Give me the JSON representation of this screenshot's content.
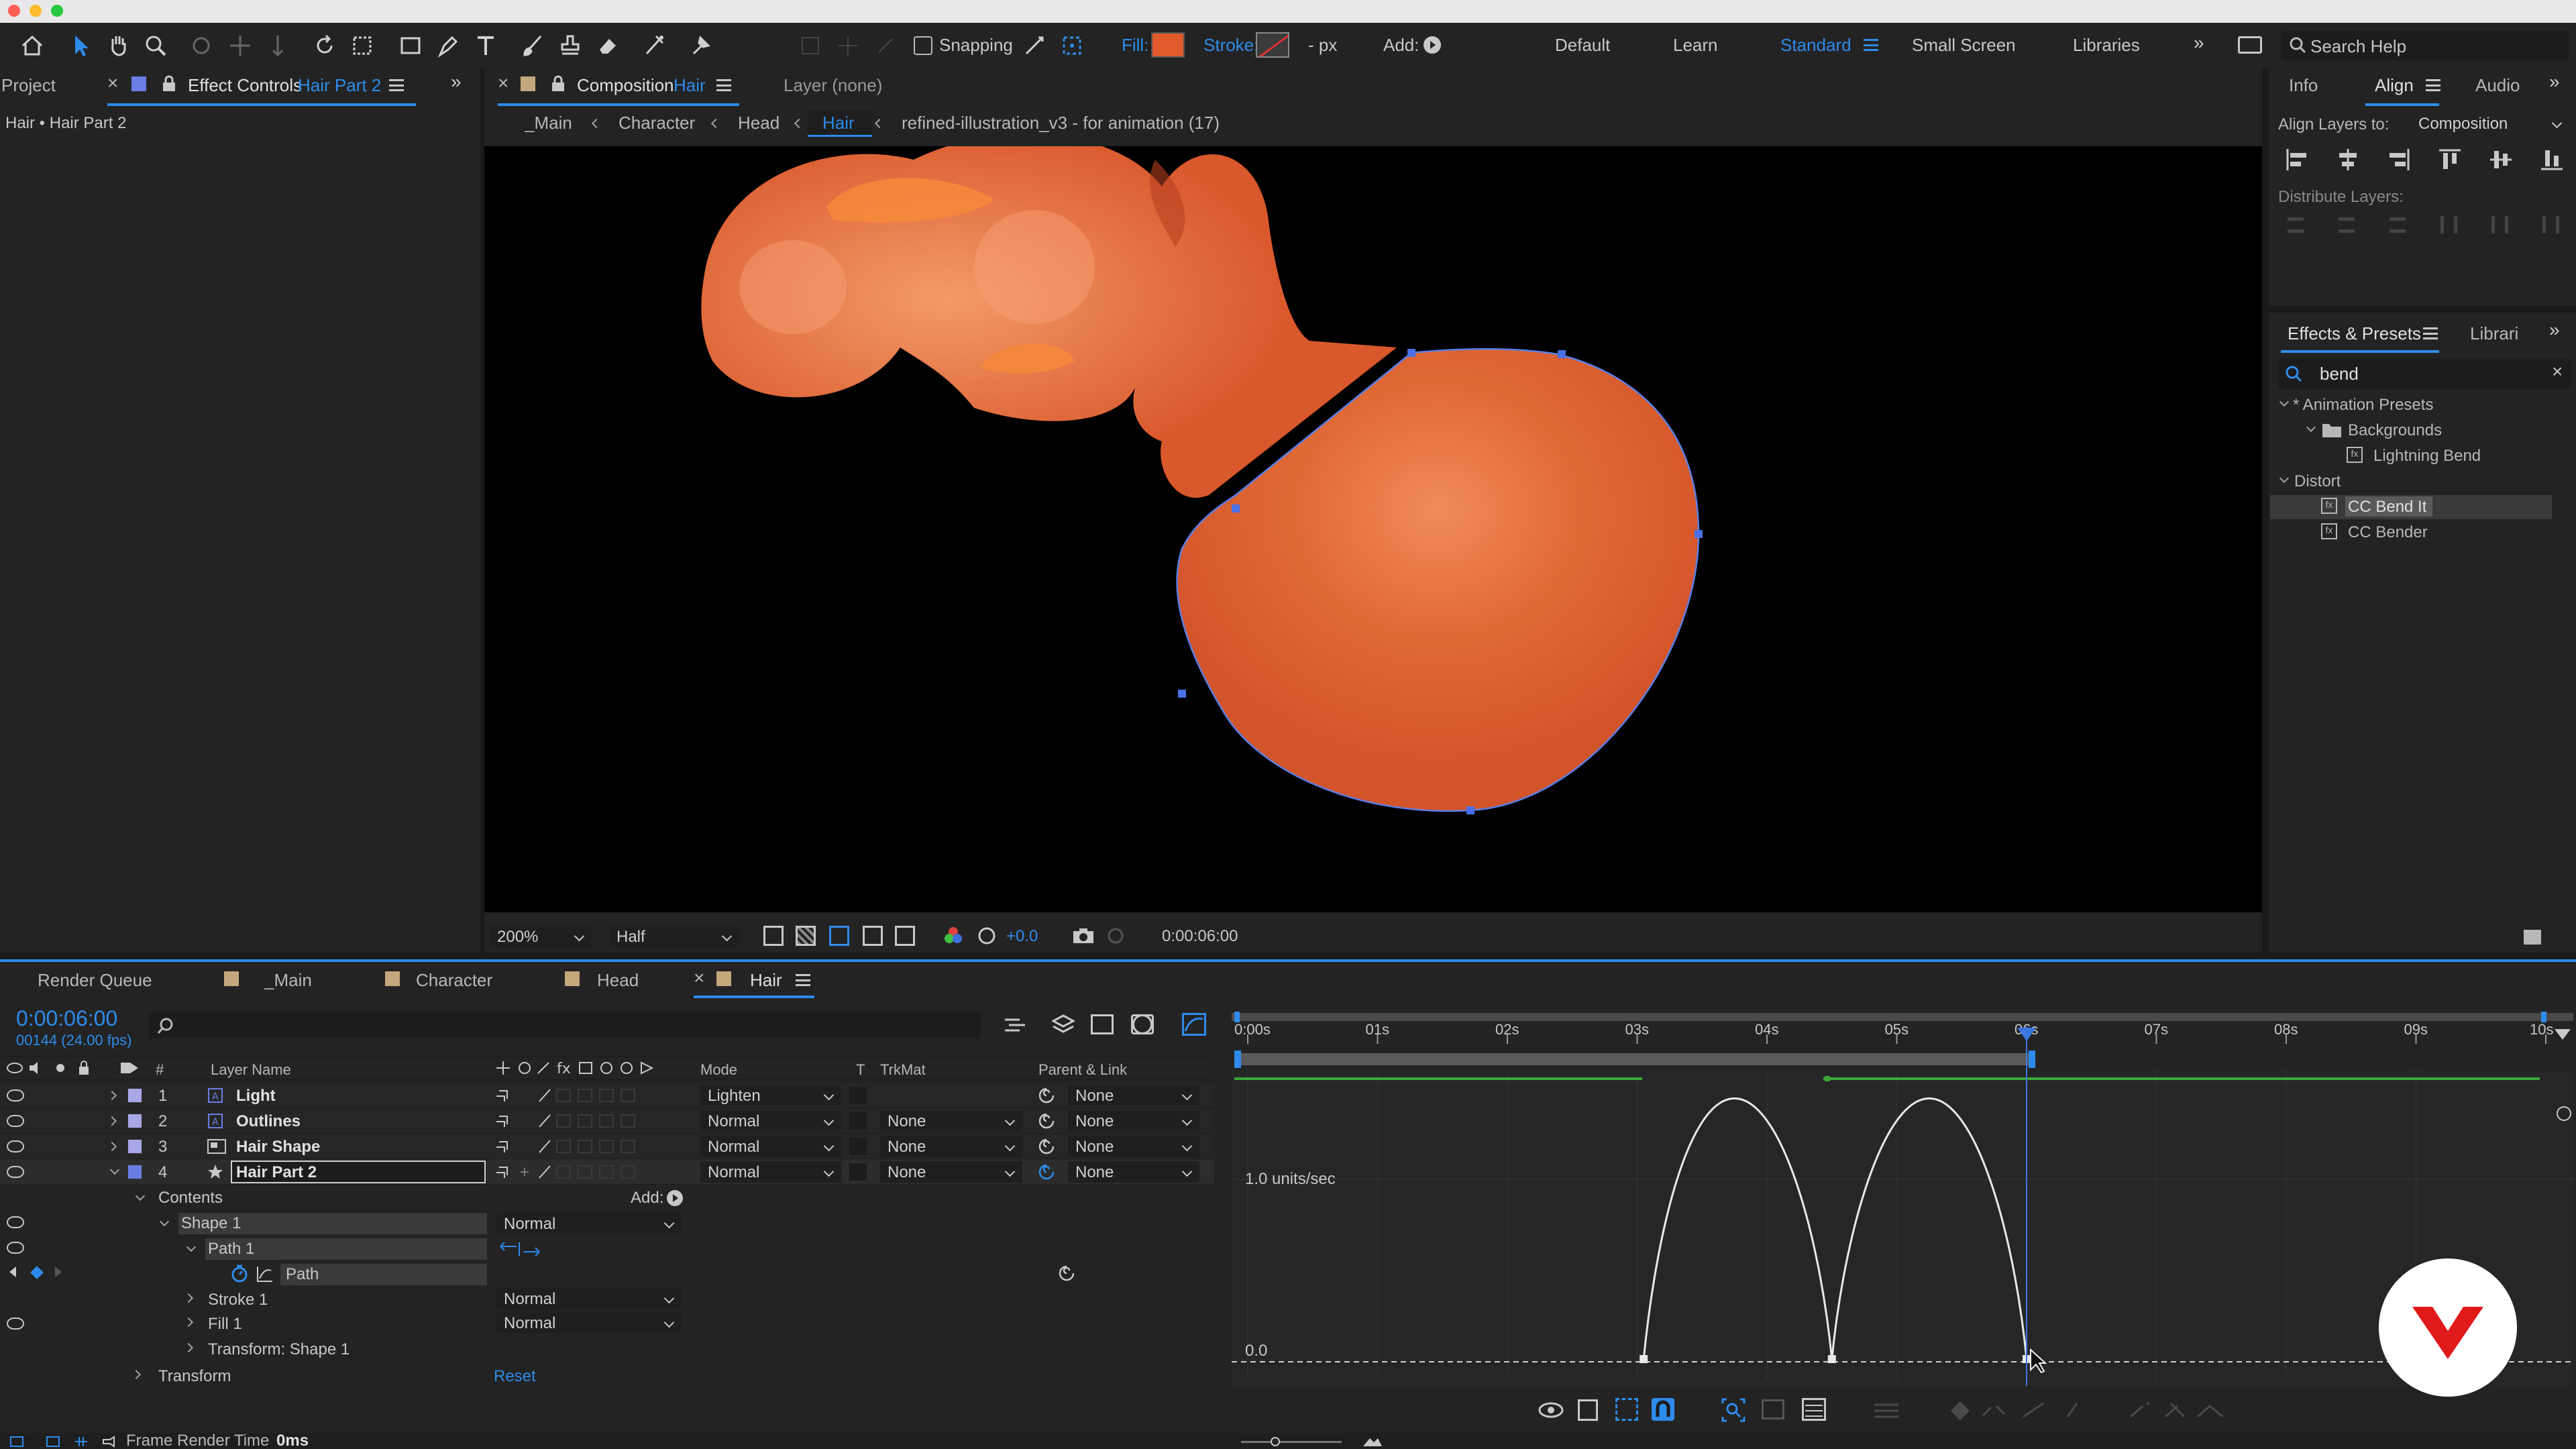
{
  "toolbar": {
    "snapping": "Snapping",
    "fill": "Fill:",
    "stroke": "Stroke:",
    "px": "- px",
    "add": "Add:",
    "workspaces": [
      "Default",
      "Learn",
      "Standard",
      "Small Screen",
      "Libraries"
    ],
    "search": "Search Help",
    "colors": {
      "fill": "#e05a2b",
      "accent": "#2d8ceb"
    }
  },
  "left_panel": {
    "tab_project": "Project",
    "tab_effect_controls": "Effect Controls",
    "effect_target": "Hair Part 2",
    "breadcrumb": "Hair • Hair Part 2"
  },
  "comp_panel": {
    "tab_composition": "Composition",
    "comp_name": "Hair",
    "layer_tab": "Layer (none)",
    "crumbs": [
      "_Main",
      "Character",
      "Head",
      "Hair"
    ],
    "crumb_tail": "refined-illustration_v3 - for animation (17)",
    "zoom": "200%",
    "resolution": "Half",
    "exposure": "+0.0",
    "timecode": "0:00:06:00"
  },
  "right_panel": {
    "tabs": [
      "Info",
      "Align",
      "Audio"
    ],
    "align_to_label": "Align Layers to:",
    "align_to_value": "Composition",
    "distribute_label": "Distribute Layers:",
    "effects_tab": "Effects & Presets",
    "libraries_tab": "Librari",
    "search_value": "bend",
    "tree": [
      {
        "label": "* Animation Presets",
        "level": 0
      },
      {
        "label": "Backgrounds",
        "level": 1
      },
      {
        "label": "Lightning Bend",
        "level": 2
      },
      {
        "label": "Distort",
        "level": 0
      },
      {
        "label": "CC Bend It",
        "level": 2
      },
      {
        "label": "CC Bender",
        "level": 2
      }
    ]
  },
  "timeline": {
    "tabs": [
      "Render Queue",
      "_Main",
      "Character",
      "Head",
      "Hair"
    ],
    "timecode": "0:00:06:00",
    "fps": "00144 (24.00 fps)",
    "headers": {
      "num": "#",
      "layer_name": "Layer Name",
      "mode": "Mode",
      "t": "T",
      "trkmat": "TrkMat",
      "parent": "Parent & Link"
    },
    "layers": [
      {
        "num": "1",
        "name": "Light",
        "mode": "Lighten",
        "trkmat": "",
        "parent": "None",
        "color": "#a7a7e6"
      },
      {
        "num": "2",
        "name": "Outlines",
        "mode": "Normal",
        "trkmat": "None",
        "parent": "None",
        "color": "#a7a7e6"
      },
      {
        "num": "3",
        "name": "Hair Shape",
        "mode": "Normal",
        "trkmat": "None",
        "parent": "None",
        "color": "#a7a7e6"
      },
      {
        "num": "4",
        "name": "Hair Part 2",
        "mode": "Normal",
        "trkmat": "None",
        "parent": "None",
        "color": "#6a7ee6"
      }
    ],
    "props": {
      "contents": "Contents",
      "add": "Add:",
      "shape1": "Shape 1",
      "shape1_mode": "Normal",
      "path1": "Path 1",
      "path": "Path",
      "stroke1": "Stroke 1",
      "stroke1_mode": "Normal",
      "fill1": "Fill 1",
      "fill1_mode": "Normal",
      "transform_shape": "Transform: Shape 1",
      "transform": "Transform",
      "reset": "Reset"
    },
    "ruler": [
      "0:00s",
      "01s",
      "02s",
      "03s",
      "04s",
      "05s",
      "06s",
      "07s",
      "08s",
      "09s",
      "10s"
    ],
    "graph": {
      "upper_label": "1.0 units/sec",
      "lower_label": "0.0",
      "speed_curve": [
        {
          "t": 3.05,
          "v": 0
        },
        {
          "t": 3.75,
          "v": 1.45
        },
        {
          "t": 4.5,
          "v": 0
        },
        {
          "t": 5.25,
          "v": 1.45
        },
        {
          "t": 6.0,
          "v": 0
        }
      ]
    },
    "footer": {
      "label": "Frame Render Time",
      "value": "0ms"
    }
  }
}
